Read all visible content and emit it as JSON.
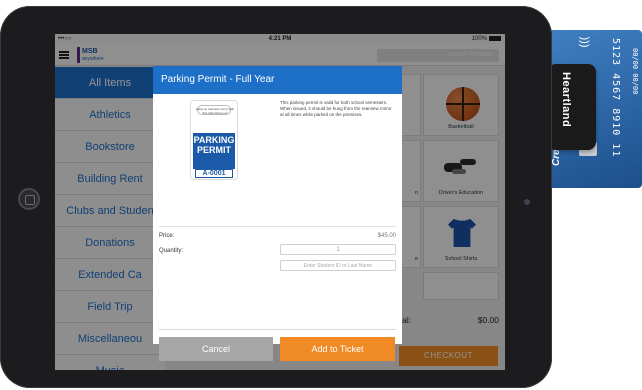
{
  "status_bar": {
    "carrier": "•••○○",
    "time": "4:21 PM",
    "battery": "100%"
  },
  "header": {
    "logo_line1": "MSB",
    "logo_line2": "anywhere",
    "search_placeholder": "Search Products"
  },
  "sidebar": {
    "items": [
      {
        "label": "All Items",
        "active": true
      },
      {
        "label": "Athletics"
      },
      {
        "label": "Bookstore"
      },
      {
        "label": "Building Rent"
      },
      {
        "label": "Clubs and Studen"
      },
      {
        "label": "Donations"
      },
      {
        "label": "Extended Ca"
      },
      {
        "label": "Field Trip"
      },
      {
        "label": "Miscellaneou"
      },
      {
        "label": "Music"
      }
    ]
  },
  "products": [
    {
      "label": "Basketball",
      "icon": "basketball-icon"
    },
    {
      "label": "Driver's Education",
      "icon": "car-keys-icon"
    },
    {
      "label": "School Shirts",
      "icon": "shirt-icon"
    }
  ],
  "partial_labels": {
    "driver": "n",
    "shirts": "e"
  },
  "cart": {
    "total_label": "otal:",
    "total_value": "$0.00",
    "checkout_label": "CHECKOUT"
  },
  "modal": {
    "title": "Parking Permit - Full Year",
    "image_text_top": "Hang on rearview mirror with this side facing out",
    "image_text_main": "PARKING PERMIT",
    "image_text_number": "A-0001",
    "description": "This parking permit is valid for both school semesters. When issued, it should be hung from the rearview mirror at all times while parked on the premises.",
    "price_label": "Price:",
    "price_value": "$45.00",
    "quantity_label": "Quantity:",
    "quantity_value": "1",
    "student_placeholder": "Enter Student ID or Last Name",
    "cancel_label": "Cancel",
    "add_label": "Add to Ticket"
  },
  "card_reader": {
    "brand": "Heartland",
    "card_brand": "Credi",
    "number_text": "5123 4567 8910 11",
    "exp_text": "00/00 00/00"
  },
  "colors": {
    "accent_blue": "#1e6fc8",
    "action_orange": "#f08a24",
    "cancel_gray": "#a6a6a6"
  }
}
